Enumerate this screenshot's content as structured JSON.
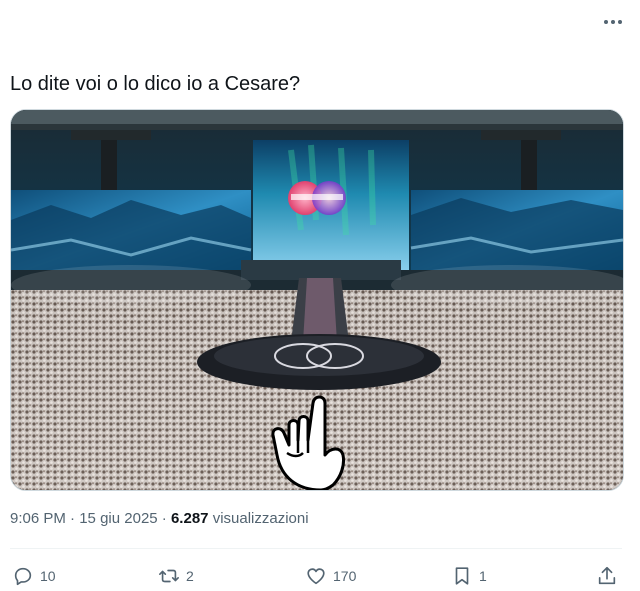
{
  "tweet": {
    "text": "Lo dite voi o lo dico io a Cesare?",
    "time": "9:06 PM",
    "date": "15 giu 2025",
    "views_count": "6.287",
    "views_label": "visualizzazioni"
  },
  "media": {
    "alt": "Concert stage with large LED screens above a dense crowd; a raised index-finger hand emoji is overlaid at the bottom center"
  },
  "actions": {
    "replies": "10",
    "reposts": "2",
    "likes": "170",
    "bookmarks": "1"
  },
  "icons": [
    "more-icon",
    "reply-icon",
    "repost-icon",
    "like-icon",
    "bookmark-icon",
    "share-icon",
    "pointing-hand-icon"
  ],
  "colors": {
    "text": "#0f1419",
    "muted": "#536471",
    "divider": "#eff3f4",
    "border": "#cfd9de"
  }
}
